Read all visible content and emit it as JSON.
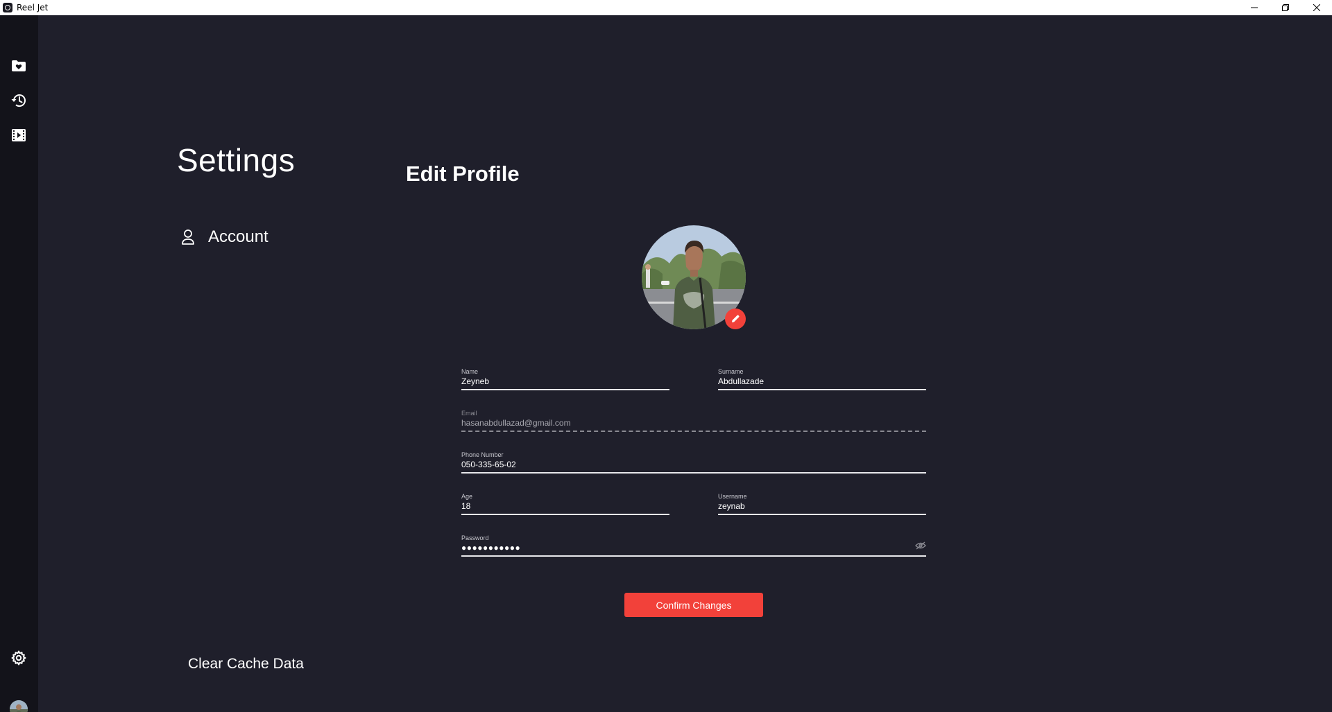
{
  "window": {
    "title": "Reel Jet"
  },
  "rail": {
    "items": [
      {
        "icon": "favorites-folder-icon"
      },
      {
        "icon": "history-icon"
      },
      {
        "icon": "film-icon"
      }
    ],
    "settings_icon": "gear-icon"
  },
  "settings": {
    "title": "Settings",
    "account_label": "Account",
    "clear_cache_label": "Clear Cache Data"
  },
  "profile": {
    "title": "Edit Profile",
    "fields": {
      "name": {
        "label": "Name",
        "value": "Zeyneb"
      },
      "surname": {
        "label": "Surname",
        "value": "Abdullazade"
      },
      "email": {
        "label": "Email",
        "value": "hasanabdullazad@gmail.com"
      },
      "phone": {
        "label": "Phone Number",
        "value": "050-335-65-02"
      },
      "age": {
        "label": "Age",
        "value": "18"
      },
      "username": {
        "label": "Username",
        "value": "zeynab"
      },
      "password": {
        "label": "Password",
        "value": "●●●●●●●●●●●"
      }
    },
    "confirm_label": "Confirm Changes"
  },
  "colors": {
    "background": "#1f1f2b",
    "rail": "#13131a",
    "accent": "#f2413a"
  }
}
